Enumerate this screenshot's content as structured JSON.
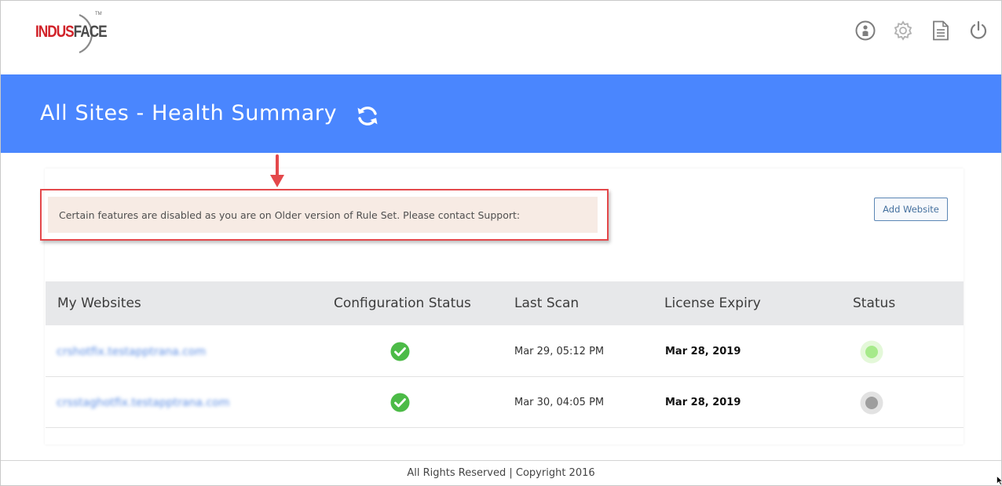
{
  "header": {
    "logo": {
      "part1": "INDUS",
      "part2": "FACE",
      "tm": "TM"
    },
    "icons": [
      "user-circle-icon",
      "gear-icon",
      "document-icon",
      "power-icon"
    ]
  },
  "banner": {
    "title": "All Sites - Health Summary"
  },
  "alert": {
    "message": "Certain features are disabled as you are on Older version of Rule Set. Please contact Support:"
  },
  "actions": {
    "add_website_label": "Add Website"
  },
  "table": {
    "headers": [
      "My Websites",
      "Configuration Status",
      "Last Scan",
      "License Expiry",
      "Status"
    ],
    "rows": [
      {
        "site": "crshotfix.testapptrana.com",
        "config_ok": true,
        "last_scan": "Mar 29, 05:12 PM",
        "expiry": "Mar 28, 2019",
        "status": "active"
      },
      {
        "site": "crsstaghotfix.testapptrana.com",
        "config_ok": true,
        "last_scan": "Mar 30, 04:05 PM",
        "expiry": "Mar 28, 2019",
        "status": "inactive"
      }
    ]
  },
  "colors": {
    "banner": "#4a86fe",
    "alert_bg": "#f7ebe4",
    "highlight_red": "#e4484b",
    "check_green": "#4cbb47",
    "status_active": "#a6ea8a",
    "status_inactive": "#9e9e9e"
  },
  "footer": {
    "text": "All Rights Reserved | Copyright 2016"
  }
}
